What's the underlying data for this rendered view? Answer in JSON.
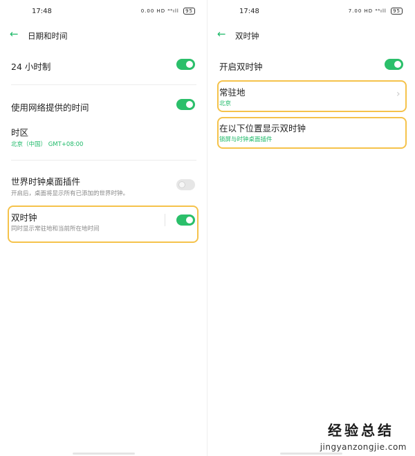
{
  "left": {
    "status": {
      "time": "17:48",
      "indicators": "0.00 HD ⁴⁶ıll",
      "battery": "95"
    },
    "header": {
      "title": "日期和时间",
      "back_icon": "arrow-left-icon"
    },
    "rows": {
      "h24": {
        "title": "24 小时制",
        "toggle": true
      },
      "net_time": {
        "title": "使用网络提供的时间",
        "toggle": true
      },
      "tz": {
        "title": "时区",
        "sub": "北京（中国） GMT+08:00"
      },
      "world_widget": {
        "title": "世界时钟桌面插件",
        "sub": "开启后，桌面将显示所有已添加的世界时钟。",
        "toggle": false
      },
      "dual": {
        "title": "双时钟",
        "sub": "同时显示常驻地和当前所在地时间",
        "toggle": true
      }
    }
  },
  "right": {
    "status": {
      "time": "17:48",
      "indicators": "7.00 HD ⁴⁶ıll",
      "battery": "95"
    },
    "header": {
      "title": "双时钟",
      "back_icon": "arrow-left-icon"
    },
    "rows": {
      "enable": {
        "title": "开启双时钟",
        "toggle": true
      },
      "home": {
        "title": "常驻地",
        "sub": "北京"
      },
      "position": {
        "title": "在以下位置显示双时钟",
        "sub": "锁屏与时钟桌面插件"
      }
    }
  },
  "watermark": {
    "main": "经验总结",
    "sub": "jingyanzongjie.com"
  },
  "colors": {
    "accent": "#1db968",
    "highlight": "#f5c24a"
  }
}
